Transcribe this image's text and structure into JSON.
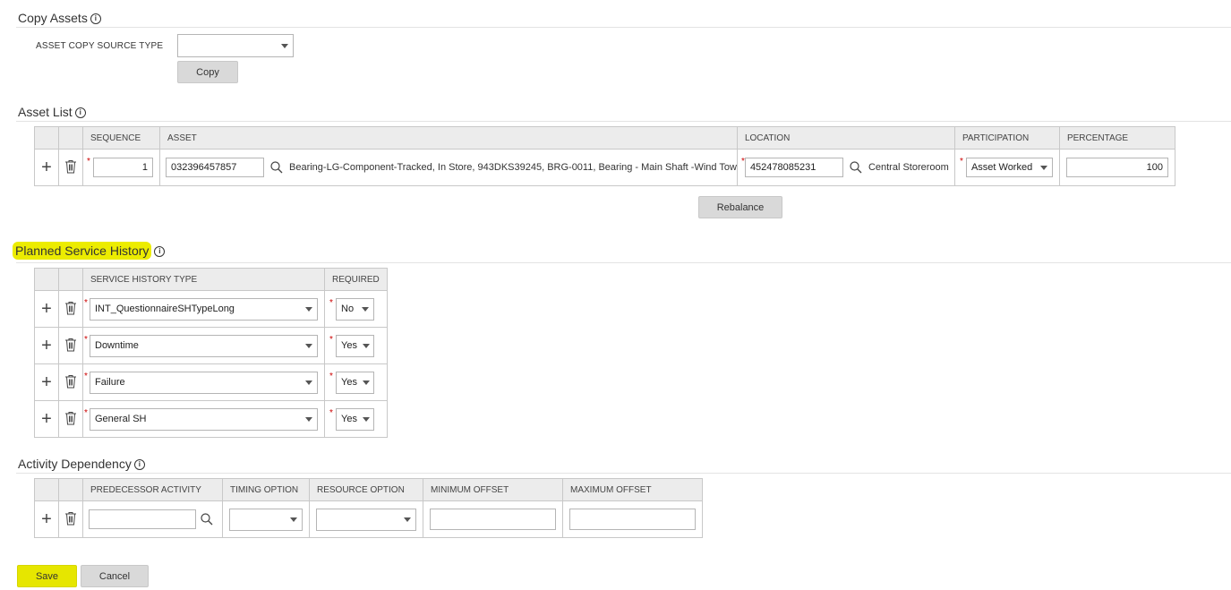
{
  "copy_assets": {
    "title": "Copy Assets",
    "source_type_label": "ASSET COPY SOURCE TYPE",
    "source_type_value": "",
    "copy_button": "Copy"
  },
  "asset_list": {
    "title": "Asset List",
    "headers": [
      "SEQUENCE",
      "ASSET",
      "LOCATION",
      "PARTICIPATION",
      "PERCENTAGE"
    ],
    "row": {
      "sequence": "1",
      "asset_code": "032396457857",
      "asset_description": "Bearing-LG-Component-Tracked, In Store, 943DKS39245, BRG-0011, Bearing - Main Shaft -Wind Tow",
      "location_code": "452478085231",
      "location_description": "Central Storeroom",
      "participation": "Asset Worked",
      "percentage": "100"
    },
    "rebalance_button": "Rebalance"
  },
  "service_history": {
    "title": "Planned Service History",
    "headers": [
      "SERVICE HISTORY TYPE",
      "REQUIRED"
    ],
    "rows": [
      {
        "type": "INT_QuestionnaireSHTypeLong",
        "required": "No"
      },
      {
        "type": "Downtime",
        "required": "Yes"
      },
      {
        "type": "Failure",
        "required": "Yes"
      },
      {
        "type": "General SH",
        "required": "Yes"
      }
    ]
  },
  "activity_dependency": {
    "title": "Activity Dependency",
    "headers": [
      "PREDECESSOR ACTIVITY",
      "TIMING OPTION",
      "RESOURCE OPTION",
      "MINIMUM OFFSET",
      "MAXIMUM OFFSET"
    ],
    "row": {
      "predecessor": "",
      "timing": "",
      "resource": "",
      "min_offset": "",
      "max_offset": ""
    }
  },
  "footer": {
    "save_button": "Save",
    "cancel_button": "Cancel"
  },
  "colors": {
    "highlight": "#ecec00",
    "required_star": "#cc0000",
    "header_bg": "#ececec"
  }
}
